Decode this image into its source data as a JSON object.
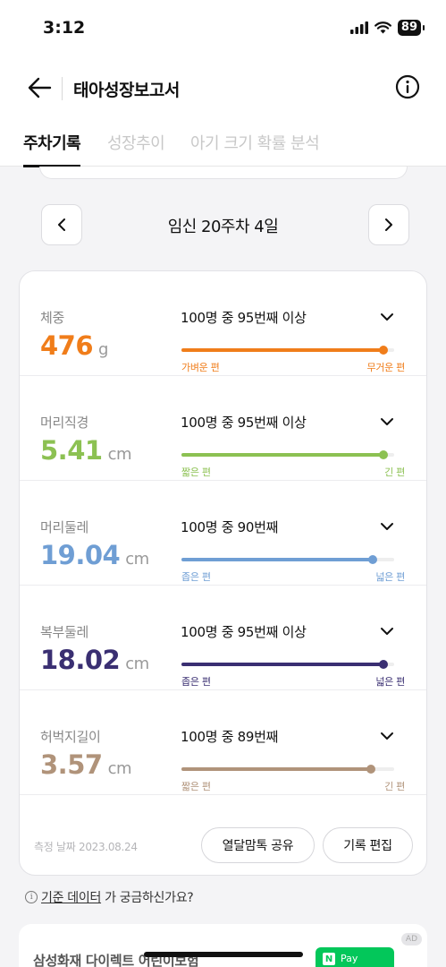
{
  "status_bar": {
    "time": "3:12",
    "battery": "89"
  },
  "header": {
    "title": "태아성장보고서"
  },
  "tabs": [
    {
      "label": "주차기록",
      "active": true
    },
    {
      "label": "성장추이",
      "active": false
    },
    {
      "label": "아기 크기 확률 분석",
      "active": false
    }
  ],
  "week_nav": {
    "label": "임신 20주차 4일"
  },
  "metrics": [
    {
      "label": "체중",
      "value": "476",
      "unit": "g",
      "rank": "100명 중 95번째 이상",
      "percentile": 0.95,
      "color": "#f07d1a",
      "left_label": "가벼운 편",
      "right_label": "무거운 편"
    },
    {
      "label": "머리직경",
      "value": "5.41",
      "unit": "cm",
      "rank": "100명 중 95번째 이상",
      "percentile": 0.95,
      "color": "#8cc152",
      "left_label": "짧은 편",
      "right_label": "긴 편"
    },
    {
      "label": "머리둘레",
      "value": "19.04",
      "unit": "cm",
      "rank": "100명 중 90번째",
      "percentile": 0.9,
      "color": "#6f9ed4",
      "left_label": "좁은 편",
      "right_label": "넓은 편"
    },
    {
      "label": "복부둘레",
      "value": "18.02",
      "unit": "cm",
      "rank": "100명 중 95번째 이상",
      "percentile": 0.95,
      "color": "#3a2f72",
      "left_label": "좁은 편",
      "right_label": "넓은 편"
    },
    {
      "label": "허벅지길이",
      "value": "3.57",
      "unit": "cm",
      "rank": "100명 중 89번째",
      "percentile": 0.89,
      "color": "#b0937a",
      "left_label": "짧은 편",
      "right_label": "긴 편"
    }
  ],
  "footer": {
    "measured_date": "측정 날짜 2023.08.24",
    "share_button": "열달맘톡 공유",
    "edit_button": "기록 편집"
  },
  "help": {
    "icon": "ⓘ",
    "link": "기준 데이터",
    "text": "가 궁금하신가요?"
  },
  "ad": {
    "text": "삼성화재 다이렉트 어린이보험",
    "badge": "AD",
    "pay_label": "Pay",
    "pay_brand": "N"
  }
}
